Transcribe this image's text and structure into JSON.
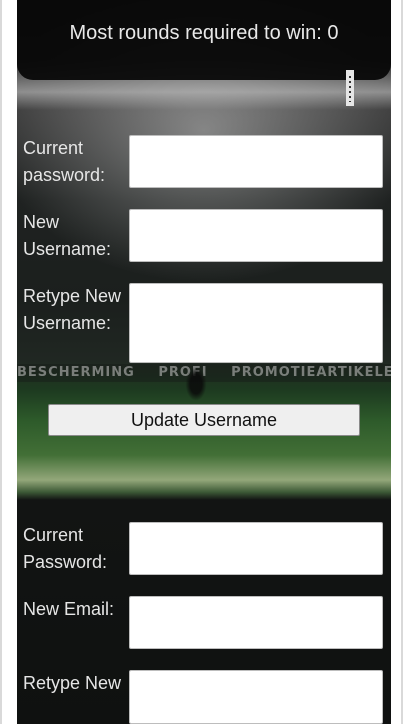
{
  "stats": {
    "most_rounds_text": "Most rounds required to win: 0"
  },
  "background": {
    "banner_texts": [
      "BESCHERMING",
      "PROFI",
      "PROMOTIEARTIKELEN"
    ]
  },
  "username_form": {
    "current_password_label": "Current password:",
    "new_username_label": "New Username:",
    "retype_username_label": "Retype New Username:",
    "current_password_value": "",
    "new_username_value": "",
    "retype_username_value": "",
    "submit_label": "Update Username"
  },
  "email_form": {
    "current_password_label": "Current Password:",
    "new_email_label": "New Email:",
    "retype_email_label": "Retype New",
    "current_password_value": "",
    "new_email_value": "",
    "retype_email_value": ""
  }
}
